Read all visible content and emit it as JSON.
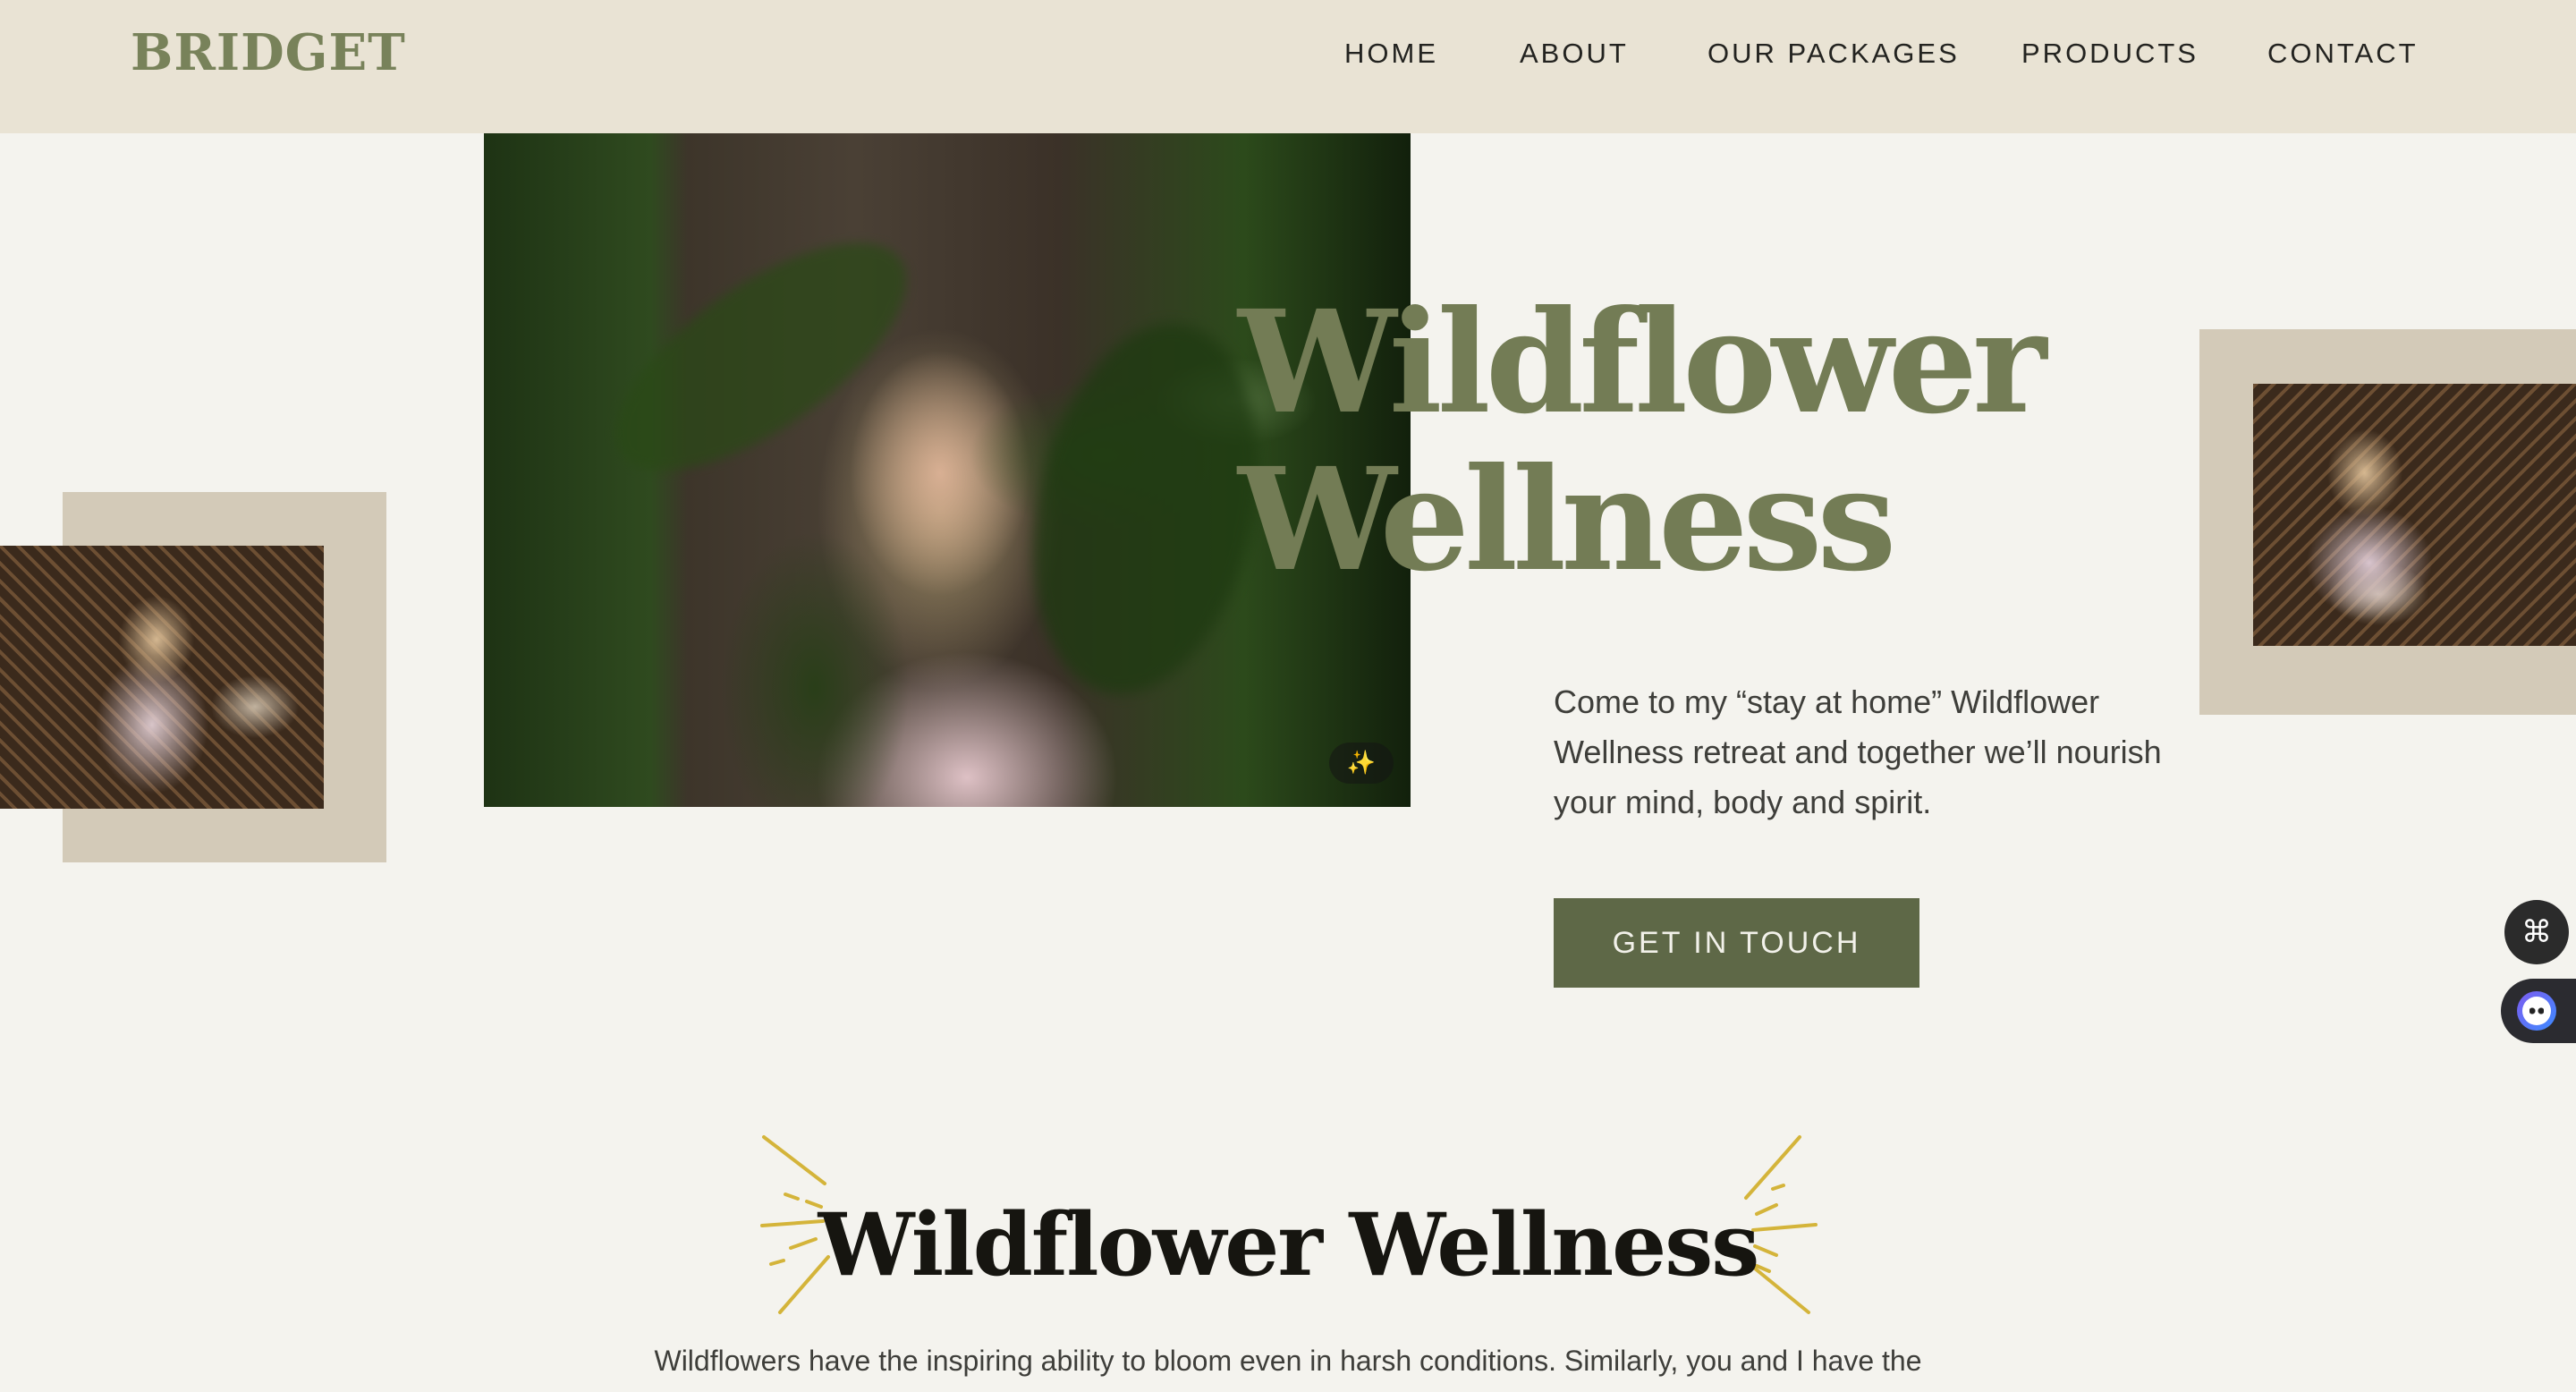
{
  "header": {
    "logo": "BRIDGET",
    "nav": [
      "HOME",
      "ABOUT",
      "OUR PACKAGES",
      "PRODUCTS",
      "CONTACT"
    ]
  },
  "hero": {
    "title": "Wildflower\nWellness",
    "description": "Come to my “stay at home” Wildflower Wellness retreat and together we’ll nourish your mind, body and spirit.",
    "cta_label": "GET IN TOUCH"
  },
  "section": {
    "title": "Wildflower Wellness",
    "text": "Wildflowers have the inspiring ability to bloom even in harsh conditions. Similarly, you and I have the"
  },
  "icons": {
    "magic": "magic-wand-icon",
    "grid": "command-icon",
    "chat": "chat-bot-icon",
    "burst": "sunburst-icon"
  },
  "colors": {
    "background": "#f4f3ee",
    "header": "#e9e3d4",
    "accent_green": "#5e6847",
    "title_green": "#737c55",
    "frame": "#d3cab8",
    "burst_gold": "#d4b43a"
  }
}
